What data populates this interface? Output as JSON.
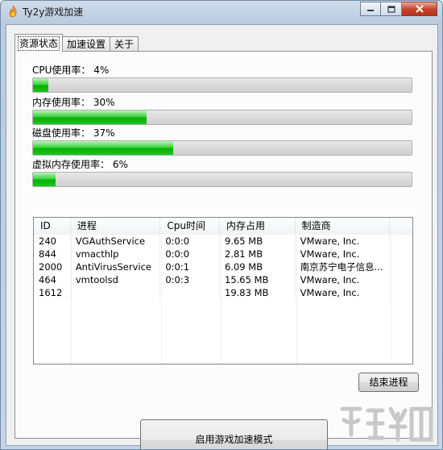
{
  "window": {
    "title": "Ty2y游戏加速"
  },
  "tabs": [
    {
      "label": "资源状态",
      "active": true
    },
    {
      "label": "加速设置",
      "active": false
    },
    {
      "label": "关于",
      "active": false
    }
  ],
  "metrics": {
    "cpu": {
      "label": "CPU使用率：  4%",
      "value": 0.04
    },
    "memory": {
      "label": "内存使用率：  30%",
      "value": 0.3
    },
    "disk": {
      "label": "磁盘使用率：  37%",
      "value": 0.37
    },
    "virtual": {
      "label": "虚拟内存使用率：  6%",
      "value": 0.06
    }
  },
  "process_list": {
    "columns": [
      "ID",
      "进程",
      "Cpu时间",
      "内存占用",
      "制造商"
    ],
    "rows": [
      [
        "240",
        "VGAuthService",
        "0:0:0",
        "9.65 MB",
        "VMware, Inc."
      ],
      [
        "844",
        "vmacthlp",
        "0:0:0",
        "2.81 MB",
        "VMware, Inc."
      ],
      [
        "2000",
        "AntiVirusService",
        "0:0:1",
        "6.09 MB",
        "南京苏宁电子信息..."
      ],
      [
        "464",
        "vmtoolsd",
        "0:0:3",
        "15.65 MB",
        "VMware, Inc."
      ],
      [
        "1612",
        "",
        "",
        "19.83 MB",
        "VMware, Inc."
      ]
    ]
  },
  "buttons": {
    "end_process": "结束进程",
    "boost_mode": "启用游戏加速模式"
  },
  "colors": {
    "progress_fill": "#20c420",
    "title_bar": "#c4d4e6",
    "close_button": "#c9472f"
  }
}
